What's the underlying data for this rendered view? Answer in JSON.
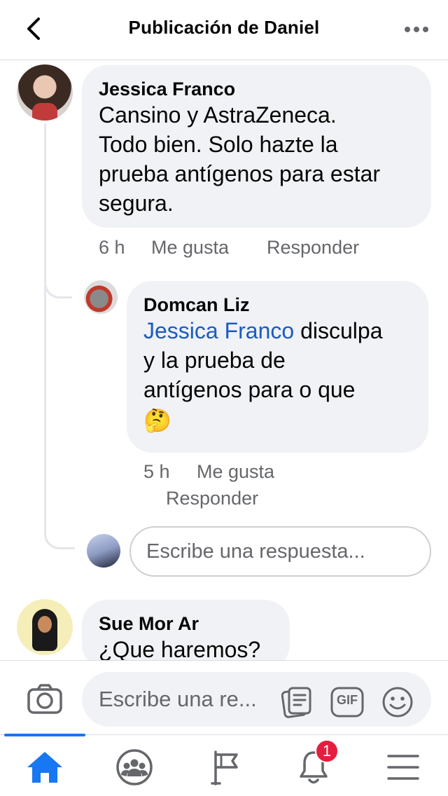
{
  "header": {
    "title": "Publicación de Daniel",
    "back_icon": "chevron-left-icon",
    "more_icon": "more-horizontal-icon"
  },
  "comments": [
    {
      "author": "Jessica Franco",
      "text": "Cansino y AstraZeneca. Todo bien. Solo hazte la prueba antígenos para estar segura.",
      "lines": [
        "Cansino y AstraZeneca.",
        "Todo bien. Solo hazte la",
        "prueba antígenos para estar",
        "segura."
      ],
      "time": "6 h",
      "like_label": "Me gusta",
      "reply_label": "Responder",
      "replies": [
        {
          "author": "Domcan Liz",
          "mention": "Jessica Franco",
          "line1_rest": " disculpa",
          "lines": [
            "y la prueba de",
            "antígenos para o que"
          ],
          "emoji": "🤔",
          "time": "5 h",
          "like_label": "Me gusta",
          "reply_label": "Responder"
        }
      ]
    },
    {
      "author": "Sue Mor Ar",
      "text": "¿Que haremos?"
    }
  ],
  "reply_box": {
    "placeholder": "Escribe una respuesta..."
  },
  "composer": {
    "placeholder": "Escribe una re...",
    "icons": [
      "camera-icon",
      "sticker-icon",
      "gif-icon",
      "emoji-icon"
    ],
    "gif_label": "GIF"
  },
  "tabbar": {
    "active": "home",
    "notification_count": "1",
    "accent": "#1877f2",
    "badge_color": "#e41e3f"
  }
}
